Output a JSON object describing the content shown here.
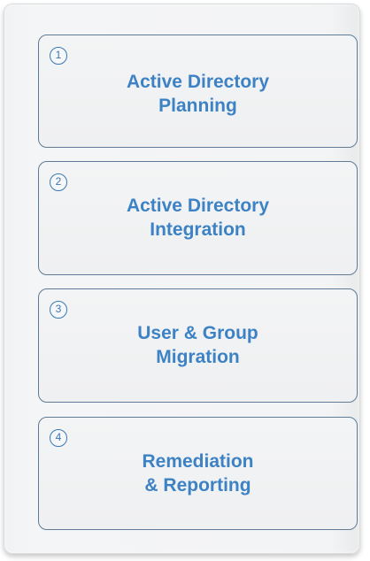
{
  "steps": [
    {
      "number": "1",
      "line1": "Active Directory",
      "line2": "Planning"
    },
    {
      "number": "2",
      "line1": "Active Directory",
      "line2": "Integration"
    },
    {
      "number": "3",
      "line1": "User & Group",
      "line2": "Migration"
    },
    {
      "number": "4",
      "line1": "Remediation",
      "line2": "& Reporting"
    }
  ],
  "colors": {
    "accent": "#3c82c4",
    "box_border": "#5f7b96",
    "panel_bg": "#f3f4f5"
  }
}
